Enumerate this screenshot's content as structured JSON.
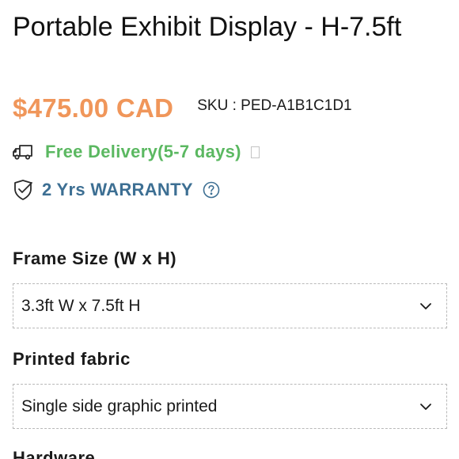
{
  "product": {
    "title": "Portable Exhibit Display - H-7.5ft",
    "price": "$475.00 CAD",
    "sku": "SKU : PED-A1B1C1D1"
  },
  "info": {
    "delivery_icon": "truck-icon",
    "delivery_text": "Free Delivery(5-7 days)",
    "warranty_icon": "shield-check-icon",
    "warranty_text": "2 Yrs WARRANTY",
    "help_icon": "question-circle-icon"
  },
  "options": {
    "frame_size": {
      "label": "Frame Size (W x H)",
      "selected": "3.3ft W x 7.5ft H",
      "icon": "chevron-down-icon"
    },
    "printed_fabric": {
      "label": "Printed fabric",
      "selected": "Single side graphic printed",
      "icon": "chevron-down-icon"
    },
    "hardware": {
      "label": "Hardware"
    }
  },
  "colors": {
    "price": "#f0965a",
    "delivery": "#5bb861",
    "warranty": "#3d6f93",
    "text": "#1a1a1a",
    "dashed_border": "#b9b9b9"
  }
}
